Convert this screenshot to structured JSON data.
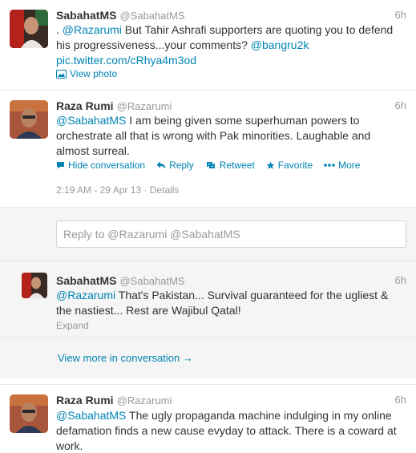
{
  "tweet1": {
    "name": "SabahatMS",
    "handle": "@SabahatMS",
    "time": "6h",
    "text": {
      "line1_pre": ". ",
      "line1_mention": "@Razarumi",
      "line1_post": " But Tahir Ashrafi supporters are quoting you to defend",
      "line2_text": "his progressiveness...your comments? ",
      "line2_mention": "@bangru2k",
      "line3_link": "pic.twitter.com/cRhya4m3od"
    },
    "view_photo": "View photo"
  },
  "tweet2": {
    "name": "Raza Rumi",
    "handle": "@Razarumi",
    "time": "6h",
    "text": {
      "line1_mention": "@SabahatMS",
      "line1_post": " I am being given some superhuman powers to",
      "line2": "orchestrate all that is wrong with Pak minorities. Laughable and",
      "line3": "almost surreal."
    },
    "actions": {
      "hide": "Hide conversation",
      "reply": "Reply",
      "retweet": "Retweet",
      "favorite": "Favorite",
      "more": "More"
    },
    "timestamp": "2:19 AM - 29 Apr 13",
    "separator": "·",
    "details": "Details"
  },
  "reply_box": {
    "placeholder": "Reply to @Razarumi @SabahatMS"
  },
  "tweet3": {
    "name": "SabahatMS",
    "handle": "@SabahatMS",
    "time": "6h",
    "text": {
      "line1_mention": "@Razarumi",
      "line1_post": " That's Pakistan... Survival guaranteed for the ugliest &",
      "line2": "the nastiest... Rest are Wajibul Qatal!"
    },
    "expand": "Expand"
  },
  "view_more": "View more in conversation →",
  "tweet4": {
    "name": "Raza Rumi",
    "handle": "@Razarumi",
    "time": "6h",
    "text": {
      "line1_mention": "@SabahatMS",
      "line1_post": " The ugly propaganda machine indulging in my online",
      "line2": "defamation finds a new cause evyday to attack. There is a coward at",
      "line3": "work."
    }
  },
  "colors": {
    "link": "#0084b4",
    "conversation_bg": "#f5f5f5",
    "border": "#e8e8e8"
  }
}
